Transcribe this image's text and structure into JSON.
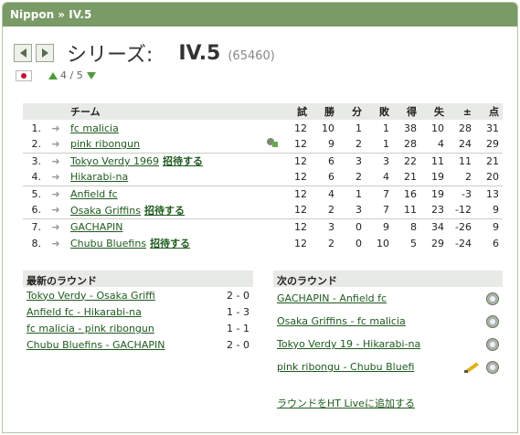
{
  "titlebar": {
    "text": "Nippon » IV.5"
  },
  "header": {
    "series_label": "シリーズ:",
    "series_name": "IV.5",
    "series_id": "(65460)",
    "position": "4 / 5"
  },
  "table": {
    "headers": [
      "チーム",
      "試",
      "勝",
      "分",
      "敗",
      "得",
      "失",
      "±",
      "点"
    ],
    "invite_label": "招待する",
    "rows": [
      {
        "pos": "1.",
        "team": "fc malicia",
        "invite": false,
        "gp": "12",
        "w": "10",
        "d": "1",
        "l": "1",
        "gf": "38",
        "ga": "10",
        "gd": "28",
        "pts": "31"
      },
      {
        "pos": "2.",
        "team": "pink ribongun",
        "invite": false,
        "mgr_icon": true,
        "gp": "12",
        "w": "9",
        "d": "2",
        "l": "1",
        "gf": "28",
        "ga": "4",
        "gd": "24",
        "pts": "29"
      },
      {
        "pos": "3.",
        "team": "Tokyo Verdy 1969",
        "invite": true,
        "gp": "12",
        "w": "6",
        "d": "3",
        "l": "3",
        "gf": "22",
        "ga": "11",
        "gd": "11",
        "pts": "21"
      },
      {
        "pos": "4.",
        "team": "Hikarabi-na",
        "invite": false,
        "gp": "12",
        "w": "6",
        "d": "2",
        "l": "4",
        "gf": "21",
        "ga": "19",
        "gd": "2",
        "pts": "20"
      },
      {
        "pos": "5.",
        "team": "Anfield fc",
        "invite": false,
        "gp": "12",
        "w": "4",
        "d": "1",
        "l": "7",
        "gf": "16",
        "ga": "19",
        "gd": "-3",
        "pts": "13"
      },
      {
        "pos": "6.",
        "team": "Osaka Griffins",
        "invite": true,
        "gp": "12",
        "w": "2",
        "d": "3",
        "l": "7",
        "gf": "11",
        "ga": "23",
        "gd": "-12",
        "pts": "9"
      },
      {
        "pos": "7.",
        "team": "GACHAPIN",
        "invite": false,
        "gp": "12",
        "w": "3",
        "d": "0",
        "l": "9",
        "gf": "8",
        "ga": "34",
        "gd": "-26",
        "pts": "9"
      },
      {
        "pos": "8.",
        "team": "Chubu Bluefins",
        "invite": true,
        "gp": "12",
        "w": "2",
        "d": "0",
        "l": "10",
        "gf": "5",
        "ga": "29",
        "gd": "-24",
        "pts": "6"
      }
    ]
  },
  "latest_round": {
    "title": "最新のラウンド",
    "matches": [
      {
        "match": "Tokyo Verdy - Osaka Griffi",
        "score": "2 - 0"
      },
      {
        "match": "Anfield fc - Hikarabi-na",
        "score": "1 - 3"
      },
      {
        "match": "fc malicia - pink ribongun",
        "score": "1 - 1"
      },
      {
        "match": "Chubu Bluefins - GACHAPIN",
        "score": "2 - 0"
      }
    ]
  },
  "next_round": {
    "title": "次のラウンド",
    "matches": [
      {
        "match": "GACHAPIN - Anfield fc"
      },
      {
        "match": "Osaka Griffins - fc malicia"
      },
      {
        "match": "Tokyo Verdy 19 - Hikarabi-na"
      },
      {
        "match": "pink ribongu - Chubu Bluefi",
        "pencil": true
      }
    ],
    "ht_live_link": "ラウンドをHT Liveに追加する"
  }
}
